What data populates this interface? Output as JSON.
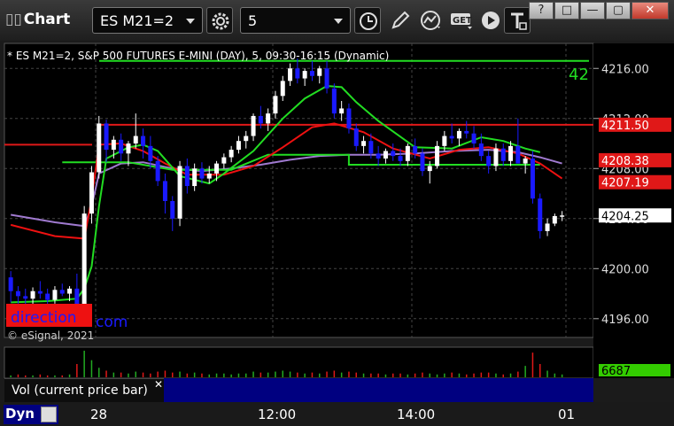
{
  "app": {
    "title": "Chart"
  },
  "toolbar": {
    "symbol": "ES M21=2",
    "interval": "5",
    "icons": [
      "gear-icon",
      "clock-icon",
      "pencil-icon",
      "study-icon",
      "get-icon",
      "play-icon",
      "text-icon"
    ]
  },
  "window_buttons": [
    "?",
    "□",
    "—",
    "▢",
    "✕"
  ],
  "chart": {
    "header": "* ES M21=2, S&P 500 FUTURES E-MINI (DAY), 5, 09:30-16:15 (Dynamic)",
    "watermark": "direction",
    "watermark_suffix": "com",
    "copyright": "© eSignal, 2021",
    "level_tag": "42",
    "vol_label": "Vol (current price bar)",
    "dyn_label": "Dyn"
  },
  "chart_data": {
    "type": "candlestick",
    "price_axis": {
      "ylim": [
        4194.5,
        4218.0
      ],
      "ticks": [
        "4216.00",
        "4212.00",
        "4208.00",
        "4204.00",
        "4200.00",
        "4196.00"
      ]
    },
    "time_axis": {
      "ticks": [
        "28",
        "12:00",
        "14:00",
        "01"
      ]
    },
    "price_labels": [
      {
        "text": "4211.50",
        "value": 4211.5,
        "color": "#e01818",
        "text_color": "#ffffff"
      },
      {
        "text": "4208.38",
        "value": 4208.38,
        "color": "#e01818",
        "text_color": "#ffffff"
      },
      {
        "text": "4207.19",
        "value": 4207.19,
        "color": "#e01818",
        "text_color": "#ffffff"
      },
      {
        "text": "4204.25",
        "value": 4204.25,
        "color": "#ffffff",
        "text_color": "#000000"
      }
    ],
    "horizontal_levels": [
      {
        "value": 4216.6,
        "color": "#22dd22"
      },
      {
        "value": 4211.5,
        "color": "#e01818"
      }
    ],
    "volume_label": {
      "text": "6687",
      "color": "#33cc00"
    },
    "colors": {
      "up": "#ffffff",
      "down": "#1a1aff",
      "ma_fast": "#22dd22",
      "ma_red": "#ee1111",
      "ma_purple": "#a07ad0"
    },
    "candles": [
      [
        4199.3,
        4199.8,
        4197.3,
        4198.2
      ],
      [
        4198.2,
        4198.6,
        4197.2,
        4197.8
      ],
      [
        4197.8,
        4198.4,
        4197.0,
        4197.6
      ],
      [
        4197.6,
        4198.5,
        4197.0,
        4198.2
      ],
      [
        4198.2,
        4199.0,
        4197.6,
        4198.0
      ],
      [
        4198.0,
        4198.4,
        4197.0,
        4197.5
      ],
      [
        4197.5,
        4198.6,
        4197.2,
        4198.3
      ],
      [
        4198.3,
        4198.8,
        4197.8,
        4198.0
      ],
      [
        4198.0,
        4198.6,
        4197.4,
        4198.4
      ],
      [
        4198.4,
        4199.6,
        4196.0,
        4195.9
      ],
      [
        4195.9,
        4205.0,
        4195.5,
        4204.4
      ],
      [
        4204.4,
        4208.2,
        4203.6,
        4207.7
      ],
      [
        4207.7,
        4212.2,
        4207.2,
        4211.6
      ],
      [
        4211.6,
        4211.9,
        4208.5,
        4209.5
      ],
      [
        4209.5,
        4210.6,
        4208.8,
        4210.3
      ],
      [
        4210.3,
        4210.8,
        4208.6,
        4209.2
      ],
      [
        4209.2,
        4210.2,
        4208.2,
        4210.0
      ],
      [
        4210.0,
        4212.4,
        4209.6,
        4210.6
      ],
      [
        4210.6,
        4211.2,
        4208.8,
        4209.8
      ],
      [
        4209.8,
        4210.6,
        4208.0,
        4208.6
      ],
      [
        4208.6,
        4209.0,
        4206.6,
        4207.0
      ],
      [
        4207.0,
        4207.6,
        4204.4,
        4205.4
      ],
      [
        4205.4,
        4205.8,
        4203.0,
        4204.0
      ],
      [
        4204.0,
        4208.6,
        4203.4,
        4208.2
      ],
      [
        4208.2,
        4208.8,
        4206.0,
        4206.6
      ],
      [
        4206.6,
        4208.4,
        4206.2,
        4208.0
      ],
      [
        4208.0,
        4208.5,
        4206.8,
        4207.2
      ],
      [
        4207.2,
        4208.2,
        4206.8,
        4207.6
      ],
      [
        4207.6,
        4208.6,
        4207.0,
        4208.4
      ],
      [
        4208.4,
        4209.2,
        4208.0,
        4208.9
      ],
      [
        4208.9,
        4209.8,
        4208.5,
        4209.5
      ],
      [
        4209.5,
        4210.6,
        4209.2,
        4210.2
      ],
      [
        4210.2,
        4211.0,
        4209.6,
        4210.6
      ],
      [
        4210.6,
        4212.4,
        4210.2,
        4212.2
      ],
      [
        4212.2,
        4213.0,
        4211.2,
        4211.6
      ],
      [
        4211.6,
        4212.8,
        4211.0,
        4212.4
      ],
      [
        4212.4,
        4214.2,
        4212.0,
        4213.8
      ],
      [
        4213.8,
        4215.4,
        4213.4,
        4215.0
      ],
      [
        4215.0,
        4216.4,
        4214.6,
        4216.0
      ],
      [
        4216.0,
        4216.8,
        4214.8,
        4215.2
      ],
      [
        4215.2,
        4216.0,
        4214.6,
        4215.8
      ],
      [
        4215.8,
        4216.6,
        4215.0,
        4215.4
      ],
      [
        4215.4,
        4216.2,
        4214.8,
        4216.0
      ],
      [
        4216.0,
        4216.6,
        4214.0,
        4214.4
      ],
      [
        4214.4,
        4214.8,
        4212.0,
        4212.4
      ],
      [
        4212.4,
        4213.4,
        4211.8,
        4212.8
      ],
      [
        4212.8,
        4213.2,
        4210.8,
        4211.2
      ],
      [
        4211.2,
        4211.6,
        4209.4,
        4209.8
      ],
      [
        4209.8,
        4210.6,
        4209.2,
        4210.2
      ],
      [
        4210.2,
        4210.8,
        4208.8,
        4209.2
      ],
      [
        4209.2,
        4209.8,
        4208.2,
        4208.8
      ],
      [
        4208.8,
        4209.6,
        4208.4,
        4209.4
      ],
      [
        4209.4,
        4210.0,
        4208.6,
        4209.0
      ],
      [
        4209.0,
        4209.6,
        4208.2,
        4208.6
      ],
      [
        4208.6,
        4210.0,
        4208.2,
        4209.8
      ],
      [
        4209.8,
        4210.4,
        4208.8,
        4209.2
      ],
      [
        4209.2,
        4209.6,
        4207.4,
        4207.8
      ],
      [
        4207.8,
        4208.6,
        4206.8,
        4208.2
      ],
      [
        4208.2,
        4210.2,
        4208.0,
        4209.8
      ],
      [
        4209.8,
        4211.0,
        4209.4,
        4210.6
      ],
      [
        4210.6,
        4211.6,
        4210.0,
        4210.4
      ],
      [
        4210.4,
        4211.2,
        4209.8,
        4211.0
      ],
      [
        4211.0,
        4211.8,
        4210.4,
        4210.8
      ],
      [
        4210.8,
        4211.4,
        4209.6,
        4210.0
      ],
      [
        4210.0,
        4210.8,
        4208.6,
        4209.0
      ],
      [
        4209.0,
        4209.4,
        4207.6,
        4208.2
      ],
      [
        4208.2,
        4210.0,
        4207.8,
        4209.6
      ],
      [
        4209.6,
        4210.0,
        4208.2,
        4208.6
      ],
      [
        4208.6,
        4210.2,
        4208.2,
        4209.8
      ],
      [
        4209.8,
        4212.0,
        4209.0,
        4208.4
      ],
      [
        4208.4,
        4209.0,
        4207.6,
        4208.8
      ],
      [
        4208.8,
        4209.4,
        4205.2,
        4205.6
      ],
      [
        4205.6,
        4206.0,
        4202.4,
        4203.0
      ],
      [
        4203.0,
        4204.0,
        4202.6,
        4203.6
      ],
      [
        4203.6,
        4204.4,
        4203.4,
        4204.2
      ],
      [
        4204.2,
        4204.6,
        4203.8,
        4204.25
      ]
    ],
    "ma_fast": [
      [
        0,
        4197.3
      ],
      [
        5,
        4197.4
      ],
      [
        9,
        4197.6
      ],
      [
        10,
        4198.4
      ],
      [
        11,
        4200.2
      ],
      [
        12,
        4205.0
      ],
      [
        13,
        4208.8
      ],
      [
        16,
        4209.7
      ],
      [
        18,
        4209.9
      ],
      [
        20,
        4209.4
      ],
      [
        23,
        4207.4
      ],
      [
        27,
        4206.8
      ],
      [
        29,
        4207.6
      ],
      [
        33,
        4209.4
      ],
      [
        37,
        4212.0
      ],
      [
        40,
        4213.6
      ],
      [
        43,
        4214.6
      ],
      [
        45,
        4214.5
      ],
      [
        47,
        4213.3
      ],
      [
        50,
        4211.8
      ],
      [
        55,
        4209.7
      ],
      [
        60,
        4209.6
      ],
      [
        64,
        4210.5
      ],
      [
        67,
        4210.2
      ],
      [
        70,
        4209.6
      ],
      [
        72,
        4209.3
      ]
    ],
    "ma_red": [
      [
        0,
        4203.5
      ],
      [
        6,
        4202.6
      ],
      [
        10,
        4202.4
      ],
      [
        11,
        4205.6
      ],
      [
        12,
        4209.9
      ],
      [
        15,
        4210.0
      ],
      [
        18,
        4209.4
      ],
      [
        21,
        4208.4
      ],
      [
        24,
        4207.5
      ],
      [
        29,
        4207.5
      ],
      [
        33,
        4208.2
      ],
      [
        37,
        4209.7
      ],
      [
        41,
        4211.3
      ],
      [
        44,
        4211.6
      ],
      [
        48,
        4210.9
      ],
      [
        52,
        4209.6
      ],
      [
        57,
        4208.8
      ],
      [
        61,
        4209.5
      ],
      [
        65,
        4209.7
      ],
      [
        69,
        4209.2
      ],
      [
        72,
        4208.4
      ],
      [
        75,
        4207.2
      ]
    ],
    "ma_purple": [
      [
        0,
        4204.3
      ],
      [
        6,
        4203.7
      ],
      [
        10,
        4203.4
      ],
      [
        11,
        4205.0
      ],
      [
        12,
        4207.6
      ],
      [
        15,
        4208.4
      ],
      [
        18,
        4208.5
      ],
      [
        22,
        4208.0
      ],
      [
        26,
        4207.8
      ],
      [
        30,
        4208.0
      ],
      [
        34,
        4208.3
      ],
      [
        38,
        4208.7
      ],
      [
        42,
        4209.0
      ],
      [
        46,
        4209.1
      ],
      [
        50,
        4209.1
      ],
      [
        55,
        4209.2
      ],
      [
        60,
        4209.4
      ],
      [
        65,
        4209.5
      ],
      [
        69,
        4209.3
      ],
      [
        72,
        4208.9
      ],
      [
        75,
        4208.4
      ]
    ],
    "ma_green_slow": [
      [
        7,
        4208.5
      ],
      [
        16,
        4208.5
      ],
      [
        22,
        4207.9
      ],
      [
        30,
        4207.9
      ],
      [
        35,
        4209.1
      ],
      [
        46,
        4209.1
      ],
      [
        46,
        4208.3
      ],
      [
        72,
        4208.3
      ]
    ],
    "volume": [
      2,
      3,
      2,
      2,
      3,
      2,
      2,
      2,
      3,
      14,
      28,
      18,
      10,
      7,
      5,
      5,
      4,
      6,
      5,
      4,
      6,
      7,
      5,
      6,
      4,
      5,
      4,
      3,
      4,
      4,
      3,
      4,
      4,
      6,
      5,
      5,
      6,
      7,
      6,
      5,
      4,
      5,
      4,
      6,
      7,
      5,
      6,
      5,
      4,
      4,
      4,
      3,
      4,
      4,
      3,
      4,
      5,
      4,
      3,
      4,
      5,
      4,
      3,
      4,
      5,
      5,
      4,
      3,
      4,
      6,
      12,
      26,
      14,
      7,
      4,
      3
    ]
  }
}
